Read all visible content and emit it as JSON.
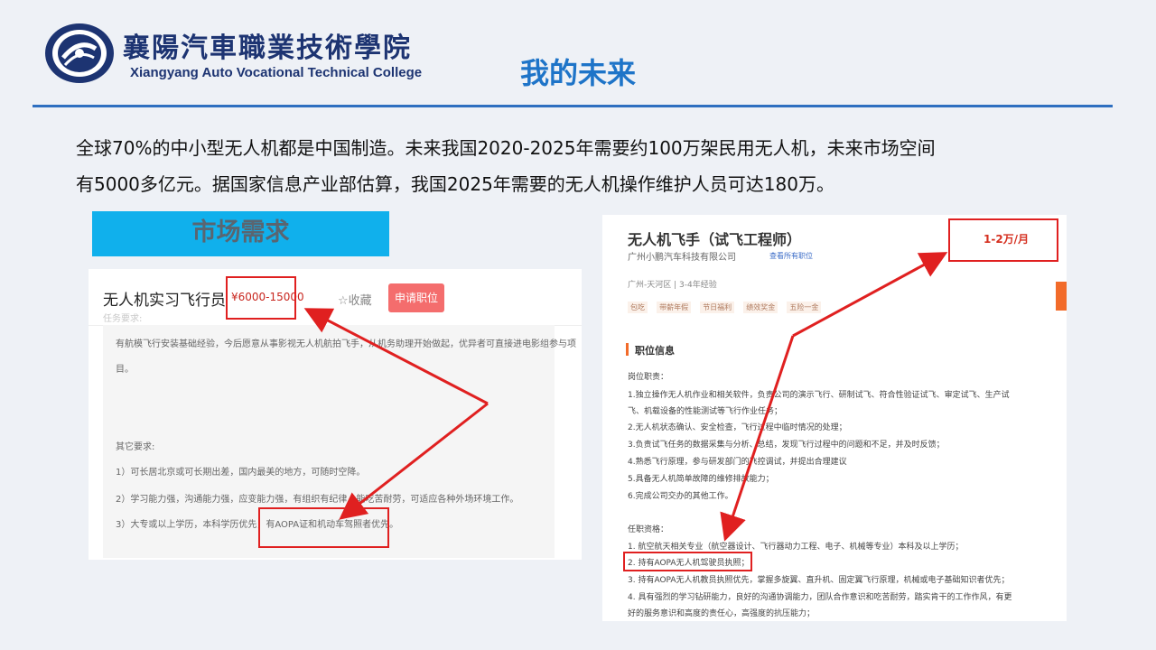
{
  "logo": {
    "cn": "襄陽汽車職業技術學院",
    "en": "Xiangyang Auto Vocational Technical College",
    "brand_color": "#1d3472"
  },
  "title": "我的未来",
  "title_color": "#1e74c8",
  "intro": {
    "line1": "全球70%的中小型无人机都是中国制造。未来我国2020-2025年需要约100万架民用无人机，未来市场空间",
    "line2": "有5000多亿元。据国家信息产业部估算，我国2025年需要的无人机操作维护人员可达180万。"
  },
  "market_tag": "市场需求",
  "left_card": {
    "job_title": "无人机实习飞行员",
    "salary": "¥6000-15000",
    "faded": "任务要求:",
    "favorite": "☆收藏",
    "apply": "申请职位",
    "para1_a": "有航模飞行安装基础经验，今后愿意从事影视无人机航拍飞手，从机务助理开始做起，优异者可直接进电影组参与项",
    "para1_b": "目。",
    "other_title": "其它要求:",
    "req1": "1）可长居北京或可长期出差，国内最美的地方，可随时空降。",
    "req2": "2）学习能力强，沟通能力强，应变能力强，有组织有纪律，能吃苦耐劳，可适应各种外场环境工作。",
    "req3": "3）大专或以上学历，本科学历优先，有AOPA证和机动车驾照者优先。"
  },
  "right_card": {
    "job_title": "无人机飞手（试飞工程师）",
    "company": "广州小鹏汽车科技有限公司",
    "see_all": "查看所有职位",
    "salary": "1-2万/月",
    "location": "广州-天河区  |  3-4年经验",
    "benefits": [
      "包吃",
      "带薪年假",
      "节日福利",
      "绩效奖金",
      "五险一金"
    ],
    "section": "职位信息",
    "duties_title": "岗位职责：",
    "duties": [
      "1.独立操作无人机作业和相关软件，负责公司的演示飞行、研制试飞、符合性验证试飞、审定试飞、生产试",
      "飞、机载设备的性能测试等飞行作业任务；",
      "2.无人机状态确认、安全检查，飞行过程中临时情况的处理；",
      "3.负责试飞任务的数据采集与分析、总结，发现飞行过程中的问题和不足，并及时反馈；",
      "4.熟悉飞行原理，参与研发部门的飞控调试，并提出合理建议",
      "5.具备无人机简单故障的维修排故能力；",
      "6.完成公司交办的其他工作。"
    ],
    "quals_title": "任职资格：",
    "quals": [
      "1. 航空航天相关专业（航空器设计、飞行器动力工程、电子、机械等专业）本科及以上学历；",
      "2. 持有AOPA无人机驾驶员执照；",
      "3. 持有AOPA无人机教员执照优先，掌握多旋翼、直升机、固定翼飞行原理，机械或电子基础知识者优先；",
      "4. 具有强烈的学习钻研能力，良好的沟通协调能力，团队合作意识和吃苦耐劳，踏实肯干的工作作风，有更",
      "好的服务意识和高度的责任心，高强度的抗压能力；"
    ]
  },
  "colors": {
    "accent_red": "#e02020",
    "tag_blue": "#10b0ec",
    "divider": "#2e6fc0"
  }
}
